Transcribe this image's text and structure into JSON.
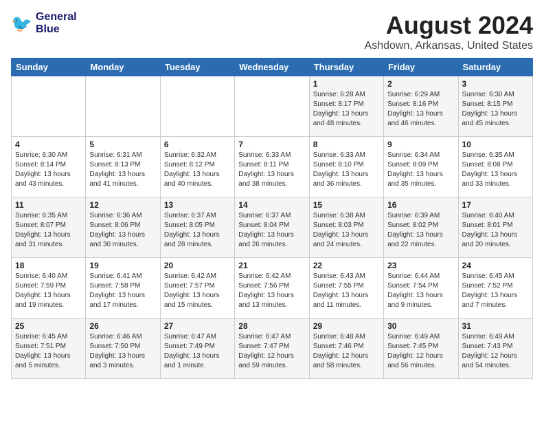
{
  "header": {
    "logo_line1": "General",
    "logo_line2": "Blue",
    "main_title": "August 2024",
    "subtitle": "Ashdown, Arkansas, United States"
  },
  "days_of_week": [
    "Sunday",
    "Monday",
    "Tuesday",
    "Wednesday",
    "Thursday",
    "Friday",
    "Saturday"
  ],
  "weeks": [
    [
      {
        "day": "",
        "detail": ""
      },
      {
        "day": "",
        "detail": ""
      },
      {
        "day": "",
        "detail": ""
      },
      {
        "day": "",
        "detail": ""
      },
      {
        "day": "1",
        "detail": "Sunrise: 6:28 AM\nSunset: 8:17 PM\nDaylight: 13 hours\nand 48 minutes."
      },
      {
        "day": "2",
        "detail": "Sunrise: 6:29 AM\nSunset: 8:16 PM\nDaylight: 13 hours\nand 46 minutes."
      },
      {
        "day": "3",
        "detail": "Sunrise: 6:30 AM\nSunset: 8:15 PM\nDaylight: 13 hours\nand 45 minutes."
      }
    ],
    [
      {
        "day": "4",
        "detail": "Sunrise: 6:30 AM\nSunset: 8:14 PM\nDaylight: 13 hours\nand 43 minutes."
      },
      {
        "day": "5",
        "detail": "Sunrise: 6:31 AM\nSunset: 8:13 PM\nDaylight: 13 hours\nand 41 minutes."
      },
      {
        "day": "6",
        "detail": "Sunrise: 6:32 AM\nSunset: 8:12 PM\nDaylight: 13 hours\nand 40 minutes."
      },
      {
        "day": "7",
        "detail": "Sunrise: 6:33 AM\nSunset: 8:11 PM\nDaylight: 13 hours\nand 38 minutes."
      },
      {
        "day": "8",
        "detail": "Sunrise: 6:33 AM\nSunset: 8:10 PM\nDaylight: 13 hours\nand 36 minutes."
      },
      {
        "day": "9",
        "detail": "Sunrise: 6:34 AM\nSunset: 8:09 PM\nDaylight: 13 hours\nand 35 minutes."
      },
      {
        "day": "10",
        "detail": "Sunrise: 6:35 AM\nSunset: 8:08 PM\nDaylight: 13 hours\nand 33 minutes."
      }
    ],
    [
      {
        "day": "11",
        "detail": "Sunrise: 6:35 AM\nSunset: 8:07 PM\nDaylight: 13 hours\nand 31 minutes."
      },
      {
        "day": "12",
        "detail": "Sunrise: 6:36 AM\nSunset: 8:06 PM\nDaylight: 13 hours\nand 30 minutes."
      },
      {
        "day": "13",
        "detail": "Sunrise: 6:37 AM\nSunset: 8:05 PM\nDaylight: 13 hours\nand 28 minutes."
      },
      {
        "day": "14",
        "detail": "Sunrise: 6:37 AM\nSunset: 8:04 PM\nDaylight: 13 hours\nand 26 minutes."
      },
      {
        "day": "15",
        "detail": "Sunrise: 6:38 AM\nSunset: 8:03 PM\nDaylight: 13 hours\nand 24 minutes."
      },
      {
        "day": "16",
        "detail": "Sunrise: 6:39 AM\nSunset: 8:02 PM\nDaylight: 13 hours\nand 22 minutes."
      },
      {
        "day": "17",
        "detail": "Sunrise: 6:40 AM\nSunset: 8:01 PM\nDaylight: 13 hours\nand 20 minutes."
      }
    ],
    [
      {
        "day": "18",
        "detail": "Sunrise: 6:40 AM\nSunset: 7:59 PM\nDaylight: 13 hours\nand 19 minutes."
      },
      {
        "day": "19",
        "detail": "Sunrise: 6:41 AM\nSunset: 7:58 PM\nDaylight: 13 hours\nand 17 minutes."
      },
      {
        "day": "20",
        "detail": "Sunrise: 6:42 AM\nSunset: 7:57 PM\nDaylight: 13 hours\nand 15 minutes."
      },
      {
        "day": "21",
        "detail": "Sunrise: 6:42 AM\nSunset: 7:56 PM\nDaylight: 13 hours\nand 13 minutes."
      },
      {
        "day": "22",
        "detail": "Sunrise: 6:43 AM\nSunset: 7:55 PM\nDaylight: 13 hours\nand 11 minutes."
      },
      {
        "day": "23",
        "detail": "Sunrise: 6:44 AM\nSunset: 7:54 PM\nDaylight: 13 hours\nand 9 minutes."
      },
      {
        "day": "24",
        "detail": "Sunrise: 6:45 AM\nSunset: 7:52 PM\nDaylight: 13 hours\nand 7 minutes."
      }
    ],
    [
      {
        "day": "25",
        "detail": "Sunrise: 6:45 AM\nSunset: 7:51 PM\nDaylight: 13 hours\nand 5 minutes."
      },
      {
        "day": "26",
        "detail": "Sunrise: 6:46 AM\nSunset: 7:50 PM\nDaylight: 13 hours\nand 3 minutes."
      },
      {
        "day": "27",
        "detail": "Sunrise: 6:47 AM\nSunset: 7:49 PM\nDaylight: 13 hours\nand 1 minute."
      },
      {
        "day": "28",
        "detail": "Sunrise: 6:47 AM\nSunset: 7:47 PM\nDaylight: 12 hours\nand 59 minutes."
      },
      {
        "day": "29",
        "detail": "Sunrise: 6:48 AM\nSunset: 7:46 PM\nDaylight: 12 hours\nand 58 minutes."
      },
      {
        "day": "30",
        "detail": "Sunrise: 6:49 AM\nSunset: 7:45 PM\nDaylight: 12 hours\nand 56 minutes."
      },
      {
        "day": "31",
        "detail": "Sunrise: 6:49 AM\nSunset: 7:43 PM\nDaylight: 12 hours\nand 54 minutes."
      }
    ]
  ]
}
